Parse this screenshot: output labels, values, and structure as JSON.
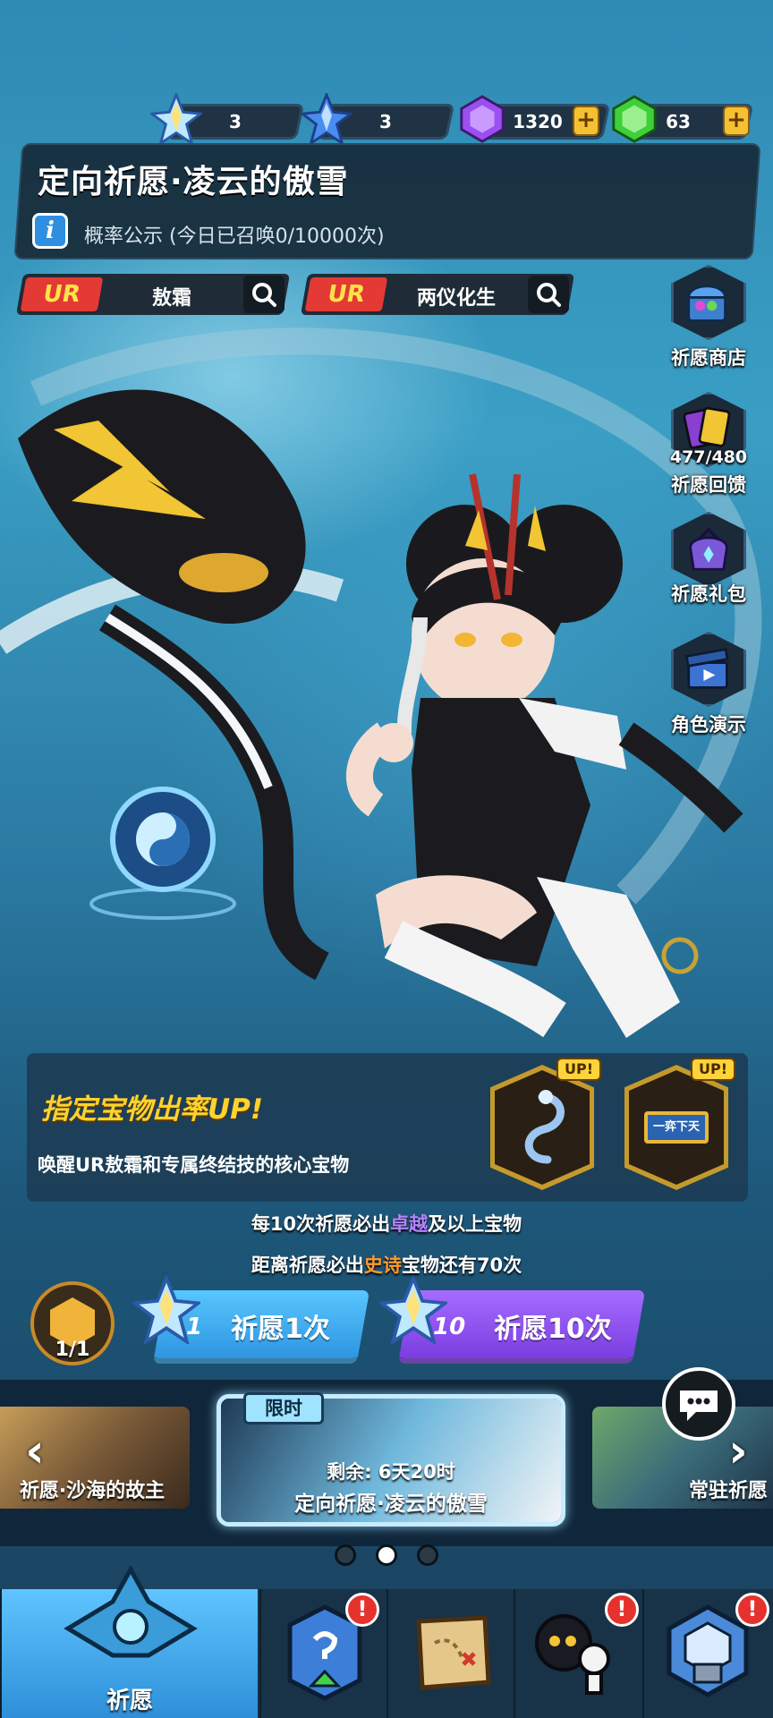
{
  "currency": {
    "crystal_single": "3",
    "crystal_ten": "3",
    "purple_gem": "1320",
    "green_gem": "63",
    "plus_label": "+"
  },
  "title": {
    "main": "定向祈愿·凌云的傲雪",
    "info_icon": "i",
    "probability_text": "概率公示 (今日已召唤0/10000次)"
  },
  "ur_search": [
    {
      "tag": "UR",
      "name": "敖霜"
    },
    {
      "tag": "UR",
      "name": "两仪化生"
    }
  ],
  "side_buttons": [
    {
      "label": "祈愿商店",
      "icon": "treasure-chest-icon"
    },
    {
      "label": "祈愿回馈",
      "count": "477/480",
      "icon": "gold-cards-icon"
    },
    {
      "label": "祈愿礼包",
      "icon": "gift-bag-icon"
    },
    {
      "label": "角色演示",
      "icon": "video-clapper-icon"
    }
  ],
  "treasure": {
    "title": "指定宝物出率UP!",
    "desc": "唤醒UR敖霜和专属终结技的核心宝物",
    "up_label": "UP!",
    "items": [
      {
        "icon": "dragon-icon"
      },
      {
        "icon": "plaque-icon",
        "text": "一弈下天"
      }
    ]
  },
  "guarantee": {
    "line1_prefix": "每10次祈愿必出",
    "line1_highlight": "卓越",
    "line1_suffix": "及以上宝物",
    "line2_prefix": "距离祈愿必出",
    "line2_highlight": "史诗",
    "line2_suffix": "宝物还有70次"
  },
  "pity": {
    "count": "1/1"
  },
  "wish_buttons": [
    {
      "cost": "1",
      "label": "祈愿1次",
      "color": "#3ab0f0"
    },
    {
      "cost": "10",
      "label": "祈愿10次",
      "color": "#8a4ef0"
    }
  ],
  "banners": {
    "left_caption": "祈愿·沙海的故主",
    "main_tag": "限时",
    "main_remaining": "剩余: 6天20时",
    "main_caption": "定向祈愿·凌云的傲雪",
    "right_caption": "常驻祈愿",
    "arrow_left": "‹",
    "arrow_right": "›"
  },
  "pagination": {
    "total": 3,
    "active": 1
  },
  "nav": {
    "active_label": "祈愿",
    "items": [
      "wish",
      "upgrade",
      "map",
      "character",
      "shop"
    ],
    "alert_mark": "!"
  },
  "colors": {
    "accent_blue": "#3ab0f0",
    "accent_purple": "#8a4ef0",
    "treasure_gold": "#ffd22e",
    "ur_red": "#e33a35",
    "highlight_purple": "#b683ff",
    "highlight_orange": "#ff9a2e"
  }
}
